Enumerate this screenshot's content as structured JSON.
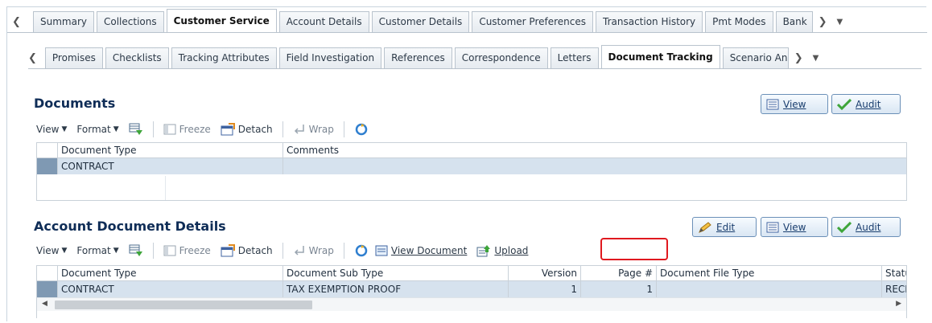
{
  "tabs_level1": {
    "items": [
      "Summary",
      "Collections",
      "Customer Service",
      "Account Details",
      "Customer Details",
      "Customer Preferences",
      "Transaction History",
      "Pmt Modes",
      "Bank"
    ],
    "active": "Customer Service"
  },
  "tabs_level2": {
    "items": [
      "Promises",
      "Checklists",
      "Tracking Attributes",
      "Field Investigation",
      "References",
      "Correspondence",
      "Letters",
      "Document Tracking",
      "Scenario Ana"
    ],
    "active": "Document Tracking"
  },
  "documents": {
    "title": "Documents",
    "buttons": {
      "view": "View",
      "audit": "Audit"
    },
    "toolbar": {
      "view": "View",
      "format": "Format",
      "freeze": "Freeze",
      "detach": "Detach",
      "wrap": "Wrap"
    },
    "columns": [
      "Document Type",
      "Comments"
    ],
    "rows": [
      [
        "CONTRACT",
        ""
      ]
    ]
  },
  "account_details": {
    "title": "Account Document Details",
    "buttons": {
      "edit": "Edit",
      "view": "View",
      "audit": "Audit"
    },
    "toolbar": {
      "view": "View",
      "format": "Format",
      "freeze": "Freeze",
      "detach": "Detach",
      "wrap": "Wrap",
      "view_document": "View Document",
      "upload": "Upload"
    },
    "columns": [
      "Document Type",
      "Document Sub Type",
      "Version",
      "Page #",
      "Document File Type",
      "Statu"
    ],
    "rows": [
      [
        "CONTRACT",
        "TAX EXEMPTION PROOF",
        "1",
        "1",
        "",
        "RECE"
      ]
    ]
  },
  "colors": {
    "accent": "#0f2d57",
    "row_selected": "#d6e2ee",
    "highlight": "#e0191f"
  }
}
